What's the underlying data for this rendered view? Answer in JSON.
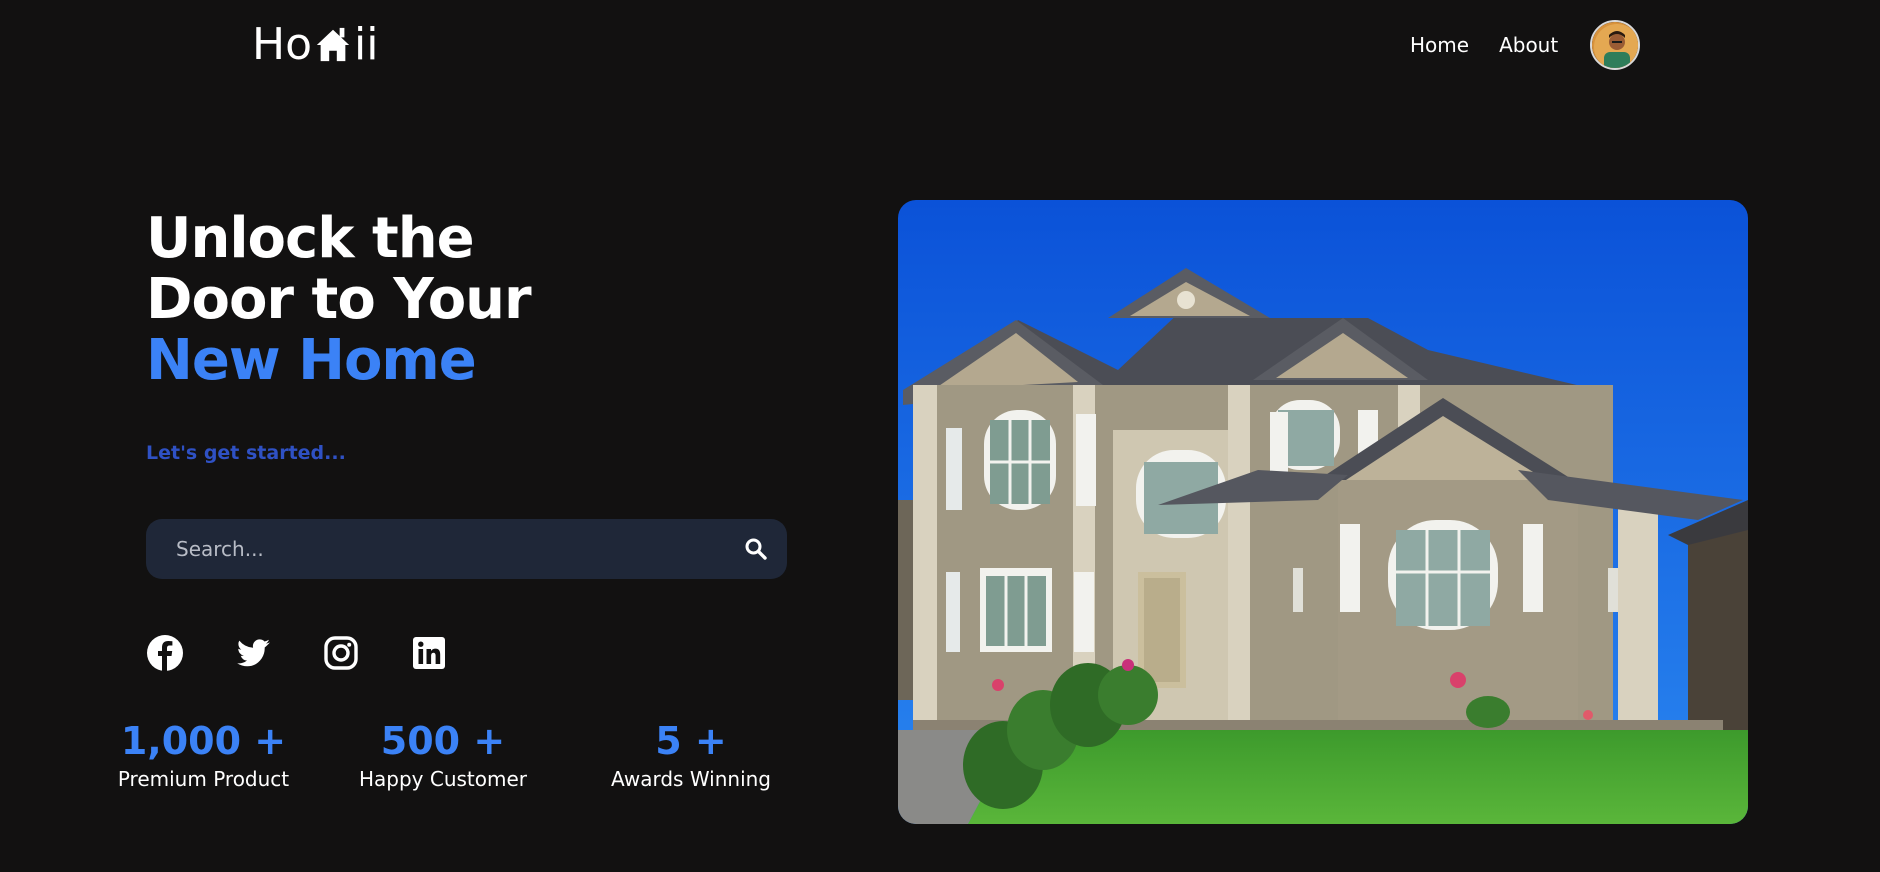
{
  "brand": {
    "name": "Hoaii",
    "prefix": "Ho",
    "suffix": "ii",
    "logo_icon": "house-icon",
    "accent_color": "#3b82f6"
  },
  "nav": {
    "items": [
      {
        "label": "Home"
      },
      {
        "label": "About"
      }
    ],
    "avatar_icon": "user-avatar"
  },
  "hero": {
    "title_line1": "Unlock the",
    "title_line2": "Door to Your",
    "title_accent": "New Home",
    "tagline": "Let's get started...",
    "image_icon": "house-photo"
  },
  "search": {
    "placeholder": "Search...",
    "value": "",
    "icon": "search-icon"
  },
  "social": [
    {
      "name": "facebook",
      "icon": "facebook-icon"
    },
    {
      "name": "twitter",
      "icon": "twitter-icon"
    },
    {
      "name": "instagram",
      "icon": "instagram-icon"
    },
    {
      "name": "linkedin",
      "icon": "linkedin-icon"
    }
  ],
  "stats": [
    {
      "value": "1,000 +",
      "label": "Premium Product"
    },
    {
      "value": "500 +",
      "label": "Happy Customer"
    },
    {
      "value": "5 +",
      "label": "Awards Winning"
    }
  ],
  "colors": {
    "background": "#121111",
    "accent": "#3b82f6",
    "tagline": "#2f51c4",
    "search_bg": "#1f2738"
  }
}
